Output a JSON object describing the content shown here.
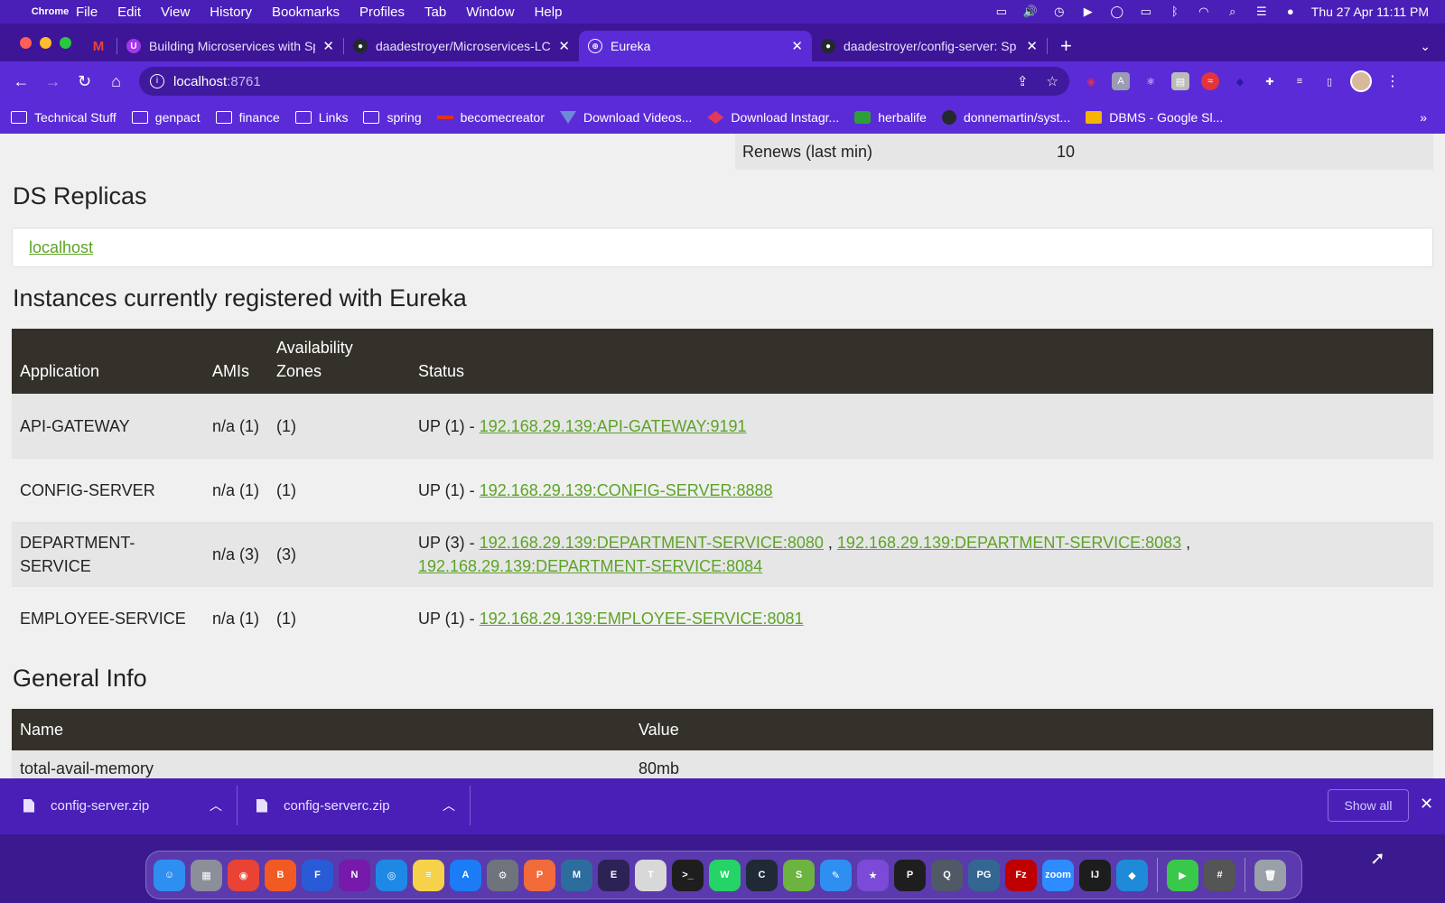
{
  "menubar": {
    "app_name": "Chrome",
    "items": [
      "File",
      "Edit",
      "View",
      "History",
      "Bookmarks",
      "Profiles",
      "Tab",
      "Window",
      "Help"
    ],
    "datetime": "Thu 27 Apr  11:11 PM"
  },
  "tabs": [
    {
      "title": "Building Microservices with Sp",
      "icon": "udemy-icon",
      "color": "#a435f0"
    },
    {
      "title": "daadestroyer/Microservices-LC",
      "icon": "github-icon",
      "color": "#24292e"
    },
    {
      "title": "Eureka",
      "icon": "globe-icon",
      "color": "#5b2bd8",
      "active": true
    },
    {
      "title": "daadestroyer/config-server: Sp",
      "icon": "github-icon",
      "color": "#24292e"
    }
  ],
  "toolbar": {
    "url_host": "localhost",
    "url_port": ":8761"
  },
  "bookmarks": [
    {
      "label": "Technical Stuff",
      "type": "folder"
    },
    {
      "label": "genpact",
      "type": "folder"
    },
    {
      "label": "finance",
      "type": "folder"
    },
    {
      "label": "Links",
      "type": "folder"
    },
    {
      "label": "spring",
      "type": "folder"
    },
    {
      "label": "becomecreator",
      "type": "site",
      "color": "#e0321a"
    },
    {
      "label": "Download Videos...",
      "type": "site",
      "color": "#6d8ad8"
    },
    {
      "label": "Download Instagr...",
      "type": "site",
      "color": "#e03a5a"
    },
    {
      "label": "herbalife",
      "type": "site",
      "color": "#2e9e3a"
    },
    {
      "label": "donnemartin/syst...",
      "type": "site",
      "color": "#24292e"
    },
    {
      "label": "DBMS - Google Sl...",
      "type": "site",
      "color": "#f4b400"
    }
  ],
  "page": {
    "renews_label": "Renews (last min)",
    "renews_value": "10",
    "ds_replicas_heading": "DS Replicas",
    "replica_link": "localhost",
    "instances_heading": "Instances currently registered with Eureka",
    "instances_columns": [
      "Application",
      "AMIs",
      "Availability Zones",
      "Status"
    ],
    "instances": [
      {
        "application": "API-GATEWAY",
        "amis": "n/a (1)",
        "zones": "(1)",
        "status_prefix": "UP (1) - ",
        "links": [
          "192.168.29.139:API-GATEWAY:9191"
        ]
      },
      {
        "application": "CONFIG-SERVER",
        "amis": "n/a (1)",
        "zones": "(1)",
        "status_prefix": "UP (1) - ",
        "links": [
          "192.168.29.139:CONFIG-SERVER:8888"
        ]
      },
      {
        "application": "DEPARTMENT-SERVICE",
        "amis": "n/a (3)",
        "zones": "(3)",
        "status_prefix": "UP (3) - ",
        "links": [
          "192.168.29.139:DEPARTMENT-SERVICE:8080",
          "192.168.29.139:DEPARTMENT-SERVICE:8083",
          "192.168.29.139:DEPARTMENT-SERVICE:8084"
        ]
      },
      {
        "application": "EMPLOYEE-SERVICE",
        "amis": "n/a (1)",
        "zones": "(1)",
        "status_prefix": "UP (1) - ",
        "links": [
          "192.168.29.139:EMPLOYEE-SERVICE:8081"
        ]
      }
    ],
    "general_heading": "General Info",
    "general_columns": [
      "Name",
      "Value"
    ],
    "general_rows": [
      {
        "name": "total-avail-memory",
        "value": "80mb"
      }
    ]
  },
  "downloads": {
    "items": [
      "config-server.zip",
      "config-serverc.zip"
    ],
    "show_all": "Show all"
  },
  "dock": {
    "apps": [
      {
        "name": "finder",
        "label": "☺",
        "color": "#2f8ff0"
      },
      {
        "name": "launchpad",
        "label": "▦",
        "color": "#8a8f99"
      },
      {
        "name": "chrome",
        "label": "◉",
        "color": "#e94335"
      },
      {
        "name": "brave",
        "label": "B",
        "color": "#f25a24"
      },
      {
        "name": "firefox",
        "label": "F",
        "color": "#2a5bd7"
      },
      {
        "name": "onenote",
        "label": "N",
        "color": "#7719aa"
      },
      {
        "name": "safari",
        "label": "◎",
        "color": "#1e88e5"
      },
      {
        "name": "notes",
        "label": "≡",
        "color": "#f6d24a"
      },
      {
        "name": "app-store",
        "label": "A",
        "color": "#1b7cf5"
      },
      {
        "name": "system-preferences",
        "label": "⚙",
        "color": "#6f747c"
      },
      {
        "name": "postman",
        "label": "P",
        "color": "#f26b3a"
      },
      {
        "name": "mysql-workbench",
        "label": "M",
        "color": "#2d6d9e"
      },
      {
        "name": "eclipse",
        "label": "E",
        "color": "#2c2255"
      },
      {
        "name": "textedit",
        "label": "T",
        "color": "#d8d8d8"
      },
      {
        "name": "terminal",
        "label": ">_",
        "color": "#1e1e1e"
      },
      {
        "name": "whatsapp",
        "label": "W",
        "color": "#25d366"
      },
      {
        "name": "mongodb-compass",
        "label": "C",
        "color": "#1f2a36"
      },
      {
        "name": "spring-tool-suite",
        "label": "S",
        "color": "#6db33f"
      },
      {
        "name": "pencil-app",
        "label": "✎",
        "color": "#2f8ff0"
      },
      {
        "name": "imovie",
        "label": "★",
        "color": "#7b4ad8"
      },
      {
        "name": "pycharm",
        "label": "P",
        "color": "#1e1e1e"
      },
      {
        "name": "quicktime",
        "label": "Q",
        "color": "#4f5a66"
      },
      {
        "name": "postgresql",
        "label": "PG",
        "color": "#336791"
      },
      {
        "name": "filezilla",
        "label": "Fz",
        "color": "#bf0000"
      },
      {
        "name": "zoom",
        "label": "zoom",
        "color": "#2d8cff"
      },
      {
        "name": "intellij",
        "label": "IJ",
        "color": "#1d1d1d"
      },
      {
        "name": "vscode",
        "label": "◆",
        "color": "#1e8ad8"
      },
      {
        "name": "facetime",
        "label": "▶",
        "color": "#3ac84a"
      },
      {
        "name": "calculator",
        "label": "#",
        "color": "#555"
      },
      {
        "name": "trash",
        "label": "🗑",
        "color": "#9aa0a8"
      }
    ]
  }
}
